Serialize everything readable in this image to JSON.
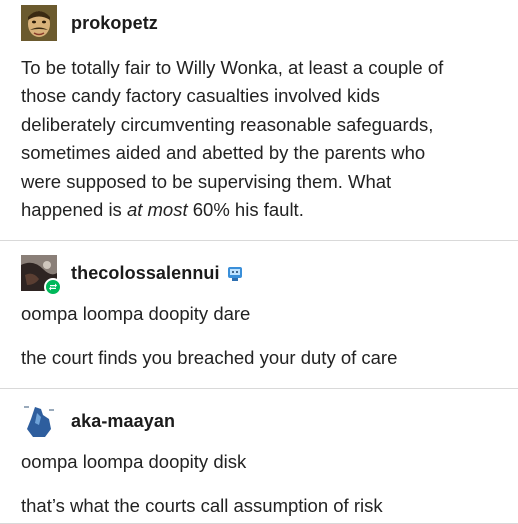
{
  "posts": [
    {
      "username": "prokopetz",
      "avatar_icon": "mustached-man-avatar",
      "lines": [
        "To be totally fair to Willy Wonka, at least a couple of",
        "those candy factory casualties involved kids",
        "deliberately circumventing reasonable safeguards,",
        "sometimes aided and abetted by the parents who",
        "were supposed to be supervising them. What"
      ],
      "last_line_prefix": "happened is ",
      "last_line_em": "at most",
      "last_line_suffix": " 60% his fault."
    },
    {
      "username": "thecolossalennui",
      "avatar_icon": "dark-photo-avatar",
      "badge_icon": "reblog-badge-icon",
      "extra_icon": "blue-blog-icon",
      "para1": "oompa loompa doopity dare",
      "para2": "the court finds you breached your duty of care"
    },
    {
      "username": "aka-maayan",
      "avatar_icon": "blue-figure-avatar",
      "para1": "oompa loompa doopity disk",
      "para2": "that’s what the courts call assumption of risk"
    }
  ],
  "colors": {
    "badge": "#00b85a",
    "divider": "#d9d9d9",
    "text": "#222222"
  }
}
